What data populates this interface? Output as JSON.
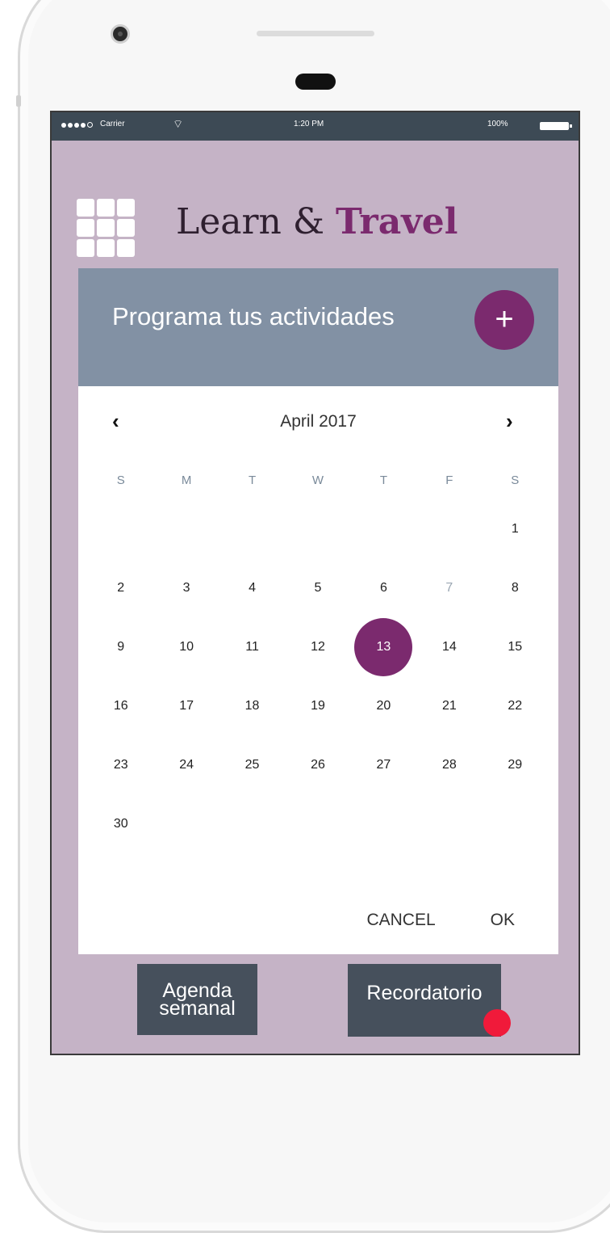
{
  "statusbar": {
    "carrier": "Carrier",
    "time": "1:20 PM",
    "battery": "100%"
  },
  "app": {
    "title_part1": "Learn & ",
    "title_part2": "Travel"
  },
  "card": {
    "title": "Programa tus actividades",
    "add_label": "+"
  },
  "calendar": {
    "prev_label": "‹",
    "next_label": "›",
    "month": "April 2017",
    "weekdays": [
      "S",
      "M",
      "T",
      "W",
      "T",
      "F",
      "S"
    ],
    "selected_day": "13",
    "cancel_label": "CANCEL",
    "ok_label": "OK"
  },
  "buttons": {
    "agenda_line1": "Agenda",
    "agenda_line2": "semanal",
    "recordatorio": "Recordatorio"
  },
  "colors": {
    "accent": "#7b2a6e",
    "background": "#c5b3c6",
    "header": "#8291a4",
    "notification": "#f01a3a"
  }
}
